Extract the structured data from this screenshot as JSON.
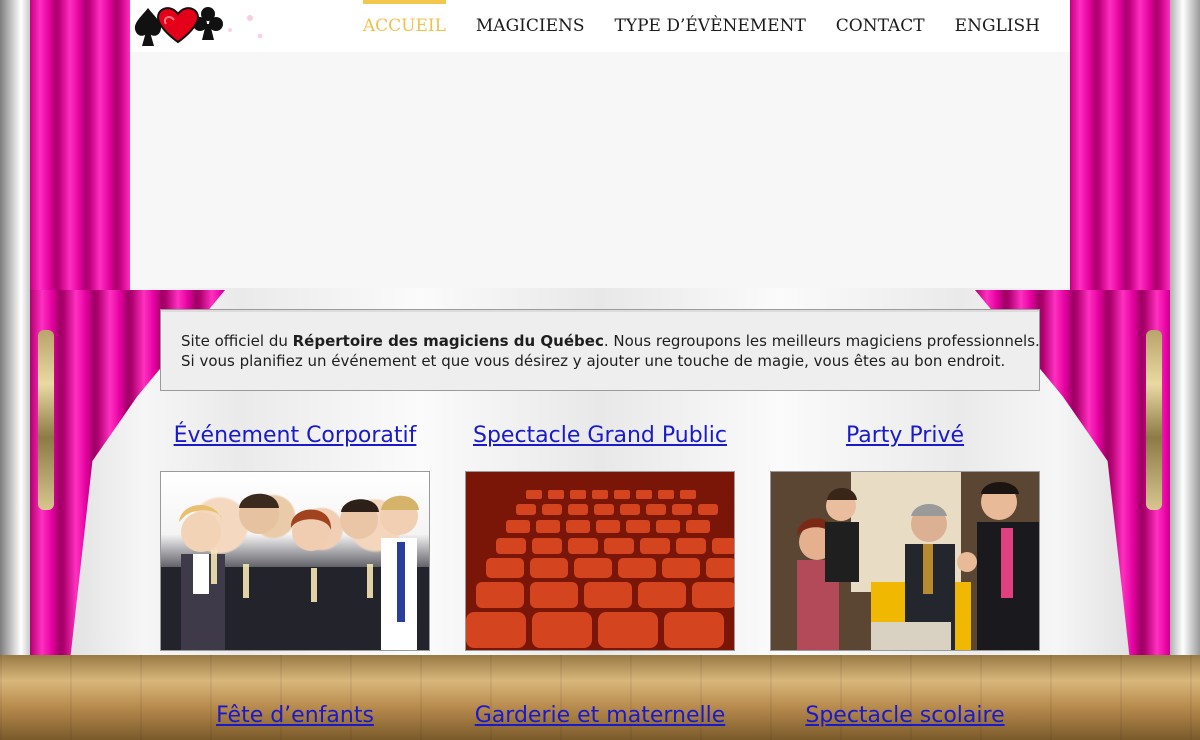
{
  "colors": {
    "curtain": "#e400a0",
    "nav_active": "#f0c24c",
    "link": "#1a1acc"
  },
  "header": {
    "logo_icon": "hearts-spades-logo-icon",
    "nav": [
      {
        "label": "ACCUEIL",
        "active": true
      },
      {
        "label": "MAGICIENS",
        "active": false
      },
      {
        "label": "TYPE D’ÉVÈNEMENT",
        "active": false
      },
      {
        "label": "CONTACT",
        "active": false
      },
      {
        "label": "ENGLISH",
        "active": false
      }
    ]
  },
  "intro": {
    "line1_prefix": "Site officiel du ",
    "line1_bold": "Répertoire des magiciens du Québec",
    "line1_suffix": ". Nous regroupons les meilleurs magiciens professionnels.",
    "line2": "Si vous planifiez un événement et que vous désirez y ajouter une touche de magie, vous êtes au bon endroit."
  },
  "categories": [
    {
      "label": "Événement Corporatif",
      "image": "corporate-team-photo"
    },
    {
      "label": "Spectacle Grand Public",
      "image": "theater-seats-photo"
    },
    {
      "label": "Party Privé",
      "image": "magician-party-photo"
    }
  ],
  "categories_bottom": [
    {
      "label": "Fête d’enfants"
    },
    {
      "label": "Garderie et maternelle"
    },
    {
      "label": "Spectacle scolaire"
    }
  ]
}
